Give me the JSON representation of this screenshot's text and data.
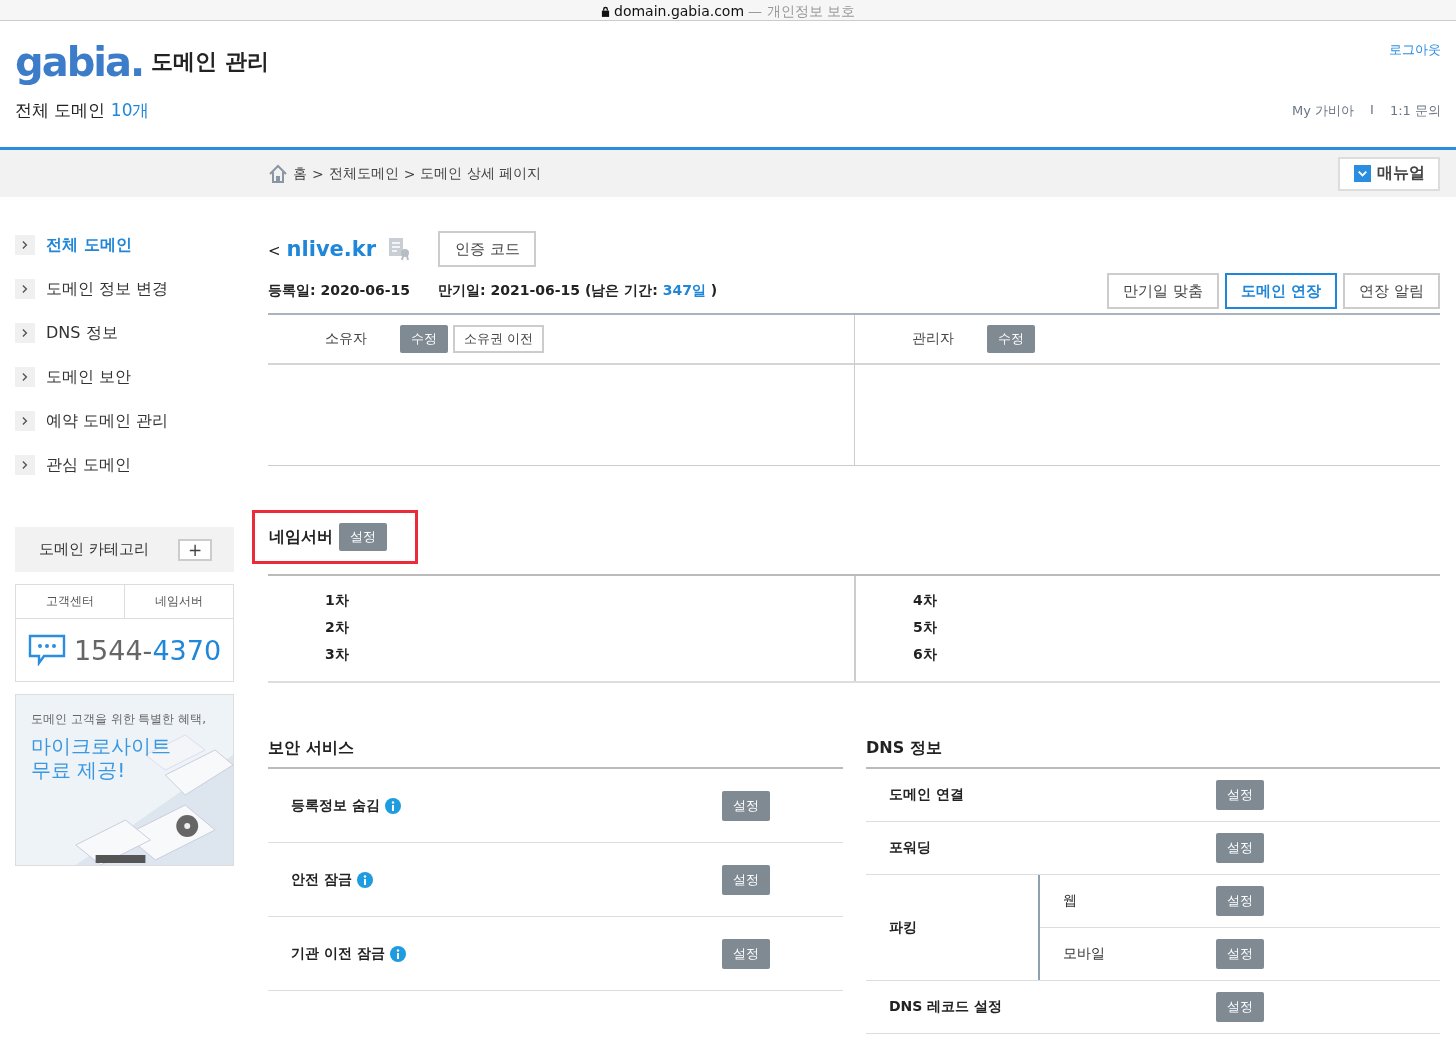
{
  "browser": {
    "url": "domain.gabia.com",
    "note": "— 개인정보 보호"
  },
  "header": {
    "logo": "gabia.",
    "title": "도메인 관리",
    "logout": "로그아웃",
    "count_label": "전체 도메인",
    "count": "10개",
    "links": [
      "My 가비아",
      "1:1 문의"
    ],
    "link_separator": "I"
  },
  "breadcrumb": {
    "items": [
      "홈",
      "전체도메인",
      "도메인 상세 페이지"
    ],
    "separator": ">",
    "manual_button": "매뉴얼"
  },
  "sidebar": {
    "items": [
      {
        "label": "전체 도메인",
        "selected": true
      },
      {
        "label": "도메인 정보 변경",
        "selected": false
      },
      {
        "label": "DNS 정보",
        "selected": false
      },
      {
        "label": "도메인 보안",
        "selected": false
      },
      {
        "label": "예약 도메인 관리",
        "selected": false
      },
      {
        "label": "관심 도메인",
        "selected": false
      }
    ],
    "category": {
      "label": "도메인 카테고리",
      "add": "+"
    },
    "support": {
      "tabs": [
        "고객센터",
        "네임서버"
      ],
      "phone_prefix": "1544-",
      "phone_suffix": "4370"
    },
    "banner": {
      "kind": "picture",
      "caption": "도메인 고객을 위한 특별한 혜택,",
      "headline": [
        "마이크로사이트",
        "무료 제공!"
      ]
    }
  },
  "domain": {
    "back": "<",
    "name": "nlive.kr",
    "auth_button": "인증 코드",
    "registered": "등록일: 2020-06-15",
    "expiry": "만기일: 2021-06-15 (남은 기간: ",
    "remaining": "347일",
    "expiry_end": ")",
    "actions": [
      {
        "label": "만기일 맞춤",
        "selected": false
      },
      {
        "label": "도메인 연장",
        "selected": true
      },
      {
        "label": "연장 알림",
        "selected": false
      }
    ]
  },
  "contacts": [
    {
      "label": "소유자",
      "buttons": [
        {
          "label": "수정",
          "kind": "filled"
        },
        {
          "label": "소유권 이전",
          "kind": "outline"
        }
      ]
    },
    {
      "label": "관리자",
      "buttons": [
        {
          "label": "수정",
          "kind": "filled"
        }
      ]
    }
  ],
  "nameserver": {
    "title": "네임서버",
    "button": "설정",
    "highlighted": true,
    "columns": [
      [
        "1차",
        "2차",
        "3차"
      ],
      [
        "4차",
        "5차",
        "6차"
      ]
    ]
  },
  "security": {
    "title": "보안 서비스",
    "rows": [
      {
        "label": "등록정보 숨김",
        "info": true,
        "button": "설정"
      },
      {
        "label": "안전 잠금",
        "info": true,
        "button": "설정"
      },
      {
        "label": "기관 이전 잠금",
        "info": true,
        "button": "설정"
      }
    ]
  },
  "dns": {
    "title": "DNS 정보",
    "rows": [
      {
        "label": "도메인 연결",
        "button": "설정"
      },
      {
        "label": "포워딩",
        "button": "설정"
      },
      {
        "label": "파킹",
        "children": [
          {
            "label": "웹",
            "button": "설정"
          },
          {
            "label": "모바일",
            "button": "설정"
          }
        ]
      },
      {
        "label": "DNS 레코드 설정",
        "button": "설정"
      }
    ]
  }
}
